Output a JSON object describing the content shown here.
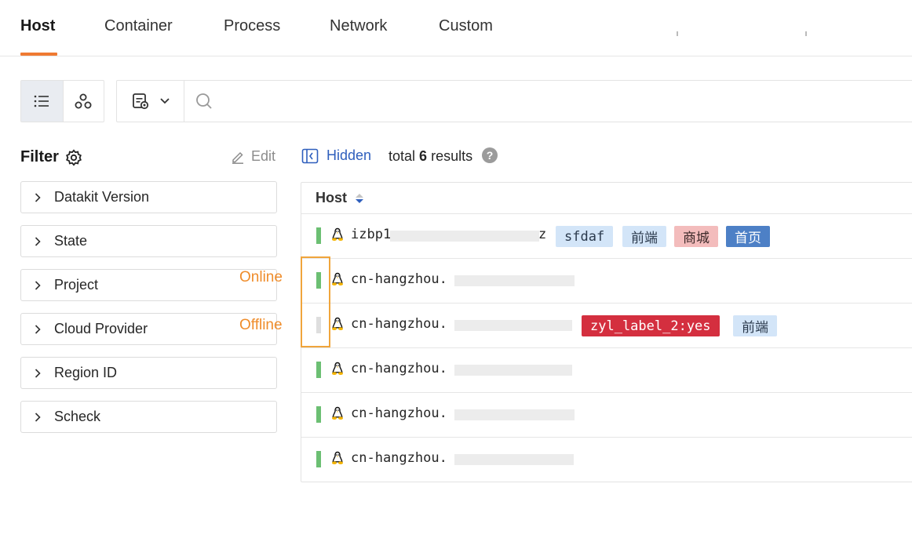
{
  "tabs": [
    {
      "label": "Host",
      "active": true
    },
    {
      "label": "Container",
      "active": false
    },
    {
      "label": "Process",
      "active": false
    },
    {
      "label": "Network",
      "active": false
    },
    {
      "label": "Custom",
      "active": false
    }
  ],
  "colors": {
    "accent": "#ef7a32",
    "online": "#6cbf73",
    "offline": "#dedede",
    "link": "#2f5fbd",
    "annotation": "#ef8c2a"
  },
  "search": {
    "placeholder": "",
    "value": ""
  },
  "view_toggle": [
    "list-icon",
    "cluster-icon"
  ],
  "filter": {
    "title": "Filter",
    "edit_label": "Edit",
    "items": [
      {
        "label": "Datakit Version"
      },
      {
        "label": "State"
      },
      {
        "label": "Project"
      },
      {
        "label": "Cloud Provider"
      },
      {
        "label": "Region ID"
      },
      {
        "label": "Scheck"
      }
    ]
  },
  "annotations": {
    "online": "Online",
    "offline": "Offline"
  },
  "results": {
    "hidden_label": "Hidden",
    "total_prefix": "total",
    "total_count": "6",
    "total_suffix": "results"
  },
  "table": {
    "header": "Host",
    "rows": [
      {
        "status": "online",
        "os": "linux-icon",
        "host": "izbp1",
        "tail": "z",
        "tags": [
          {
            "text": "sfdaf",
            "bg": "#d3e5f8",
            "color": "#2b3a4d"
          },
          {
            "text": "前端",
            "bg": "#d3e5f8",
            "color": "#2b3a4d"
          },
          {
            "text": "商城",
            "bg": "#f3bcbc",
            "color": "#3d2a2a"
          },
          {
            "text": "首页",
            "bg": "#4d80c6",
            "color": "#ffffff"
          }
        ]
      },
      {
        "status": "online",
        "os": "linux-icon",
        "host": "cn-hangzhou.",
        "tail": "",
        "tags": []
      },
      {
        "status": "offline",
        "os": "linux-icon",
        "host": "cn-hangzhou.",
        "tail": "",
        "tags": [
          {
            "text": "zyl_label_2:yes",
            "bg": "#d42f3f",
            "color": "#ffffff"
          },
          {
            "text": "前端",
            "bg": "#d3e5f8",
            "color": "#2b3a4d"
          }
        ]
      },
      {
        "status": "online",
        "os": "linux-icon",
        "host": "cn-hangzhou.",
        "tail": "",
        "tags": []
      },
      {
        "status": "online",
        "os": "linux-icon",
        "host": "cn-hangzhou.",
        "tail": "",
        "tags": []
      },
      {
        "status": "online",
        "os": "linux-icon",
        "host": "cn-hangzhou.",
        "tail": "",
        "tags": []
      }
    ]
  }
}
